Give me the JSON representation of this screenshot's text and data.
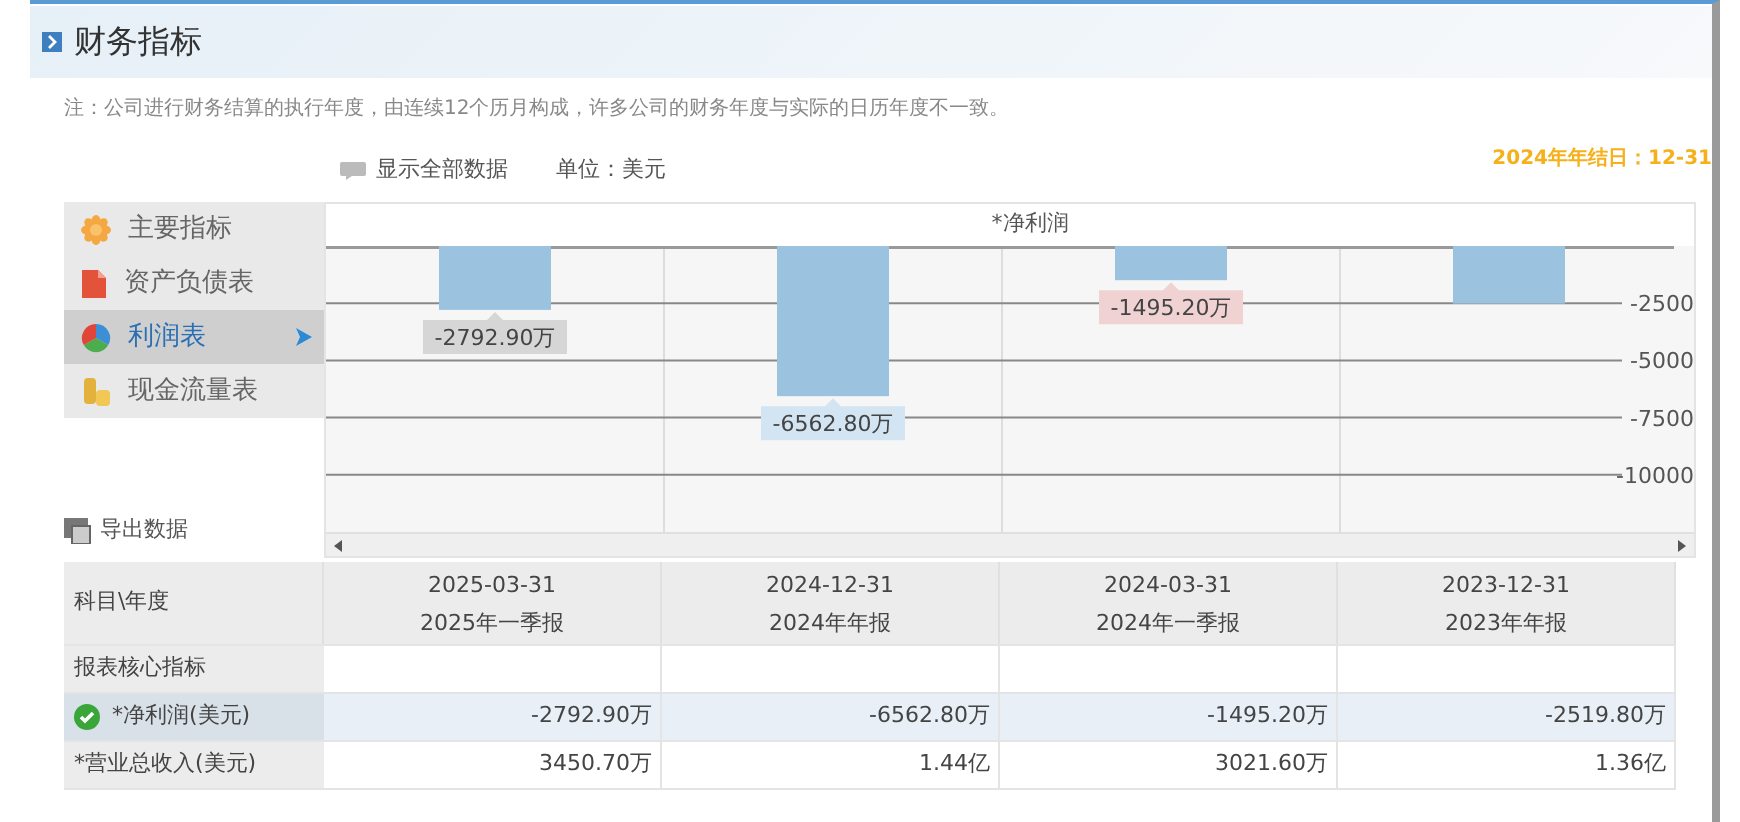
{
  "header": {
    "title": "财务指标"
  },
  "note": "注：公司进行财务结算的执行年度，由连续12个历月构成，许多公司的财务年度与实际的日历年度不一致。",
  "toolbar": {
    "show_all": "显示全部数据",
    "unit": "单位：美元",
    "year_end": "2024年年结日：12-31"
  },
  "menu": [
    {
      "label": "主要指标",
      "kind": "flower",
      "selected": false
    },
    {
      "label": "资产负债表",
      "kind": "document",
      "selected": false
    },
    {
      "label": "利润表",
      "kind": "pie",
      "selected": true
    },
    {
      "label": "现金流量表",
      "kind": "coins",
      "selected": false
    }
  ],
  "export": "导出数据",
  "chart": {
    "chart_data": {
      "type": "bar",
      "title": "*净利润",
      "grid": true,
      "series": [
        {
          "color": "#9bc3e0",
          "values": [
            -2793,
            -6563,
            -1495,
            -2520
          ]
        }
      ],
      "ylim": [
        -12500,
        0
      ],
      "yticks": [
        -2500,
        -5000,
        -7500,
        -10000
      ]
    },
    "tooltips": [
      {
        "text": "-2792.90万",
        "color": "#d6d6d6"
      },
      {
        "text": "-6562.80万",
        "color": "#d3e5f3"
      },
      {
        "text": "-1495.20万",
        "color": "#f0d2d2"
      }
    ]
  },
  "table": {
    "corner": "科目\\年度",
    "columns": [
      {
        "date": "2025-03-31",
        "report": "2025年一季报"
      },
      {
        "date": "2024-12-31",
        "report": "2024年年报"
      },
      {
        "date": "2024-03-31",
        "report": "2024年一季报"
      },
      {
        "date": "2023-12-31",
        "report": "2023年年报"
      }
    ],
    "rows": [
      {
        "label": "报表核心指标",
        "selected": false
      },
      {
        "label": "*净利润(美元)",
        "checked": true,
        "selected": true,
        "cells": [
          "-2792.90万",
          "-6562.80万",
          "-1495.20万",
          "-2519.80万"
        ]
      },
      {
        "label": "*营业总收入(美元)",
        "checked": false,
        "selected": false,
        "cells": [
          "3450.70万",
          "1.44亿",
          "3021.60万",
          "1.36亿"
        ]
      }
    ]
  }
}
